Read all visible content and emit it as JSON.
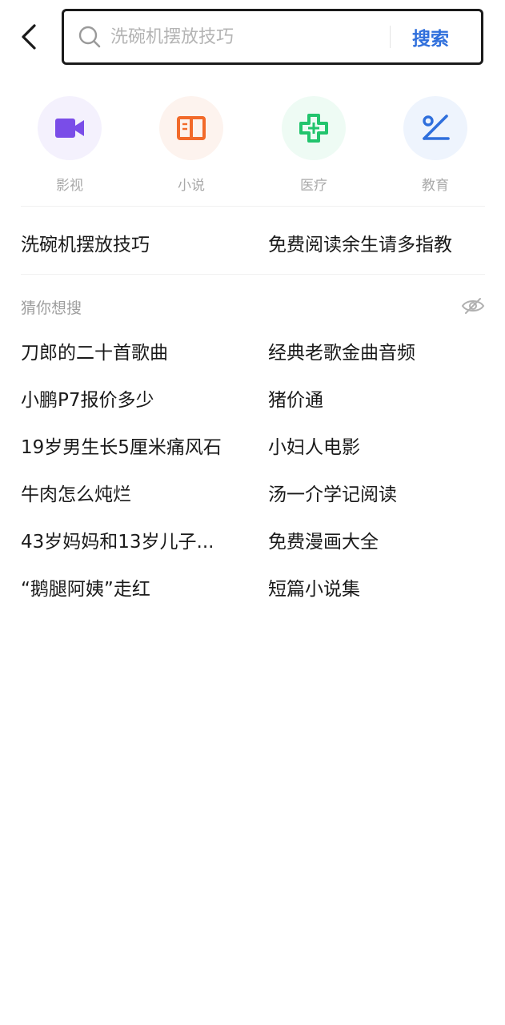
{
  "search": {
    "placeholder": "洗碗机摆放技巧",
    "submit_label": "搜索"
  },
  "categories": [
    {
      "label": "影视",
      "icon": "video-icon",
      "color": "#7a4de8",
      "bg": "#f4f1fd"
    },
    {
      "label": "小说",
      "icon": "book-icon",
      "color": "#f26a2a",
      "bg": "#fdf3ee"
    },
    {
      "label": "医疗",
      "icon": "medical-cross-icon",
      "color": "#22c46d",
      "bg": "#eefbf4"
    },
    {
      "label": "教育",
      "icon": "education-icon",
      "color": "#2f6fdc",
      "bg": "#eef4fd"
    }
  ],
  "history": [
    "洗碗机摆放技巧",
    "免费阅读余生请多指教"
  ],
  "suggestions": {
    "title": "猜你想搜",
    "items": [
      "刀郎的二十首歌曲",
      "经典老歌金曲音频",
      "小鹏P7报价多少",
      "猪价通",
      "19岁男生长5厘米痛风石",
      "小妇人电影",
      "牛肉怎么炖烂",
      "汤一介学记阅读",
      "43岁妈妈和13岁儿子...",
      "免费漫画大全",
      "“鹅腿阿姨”走红",
      "短篇小说集"
    ]
  }
}
